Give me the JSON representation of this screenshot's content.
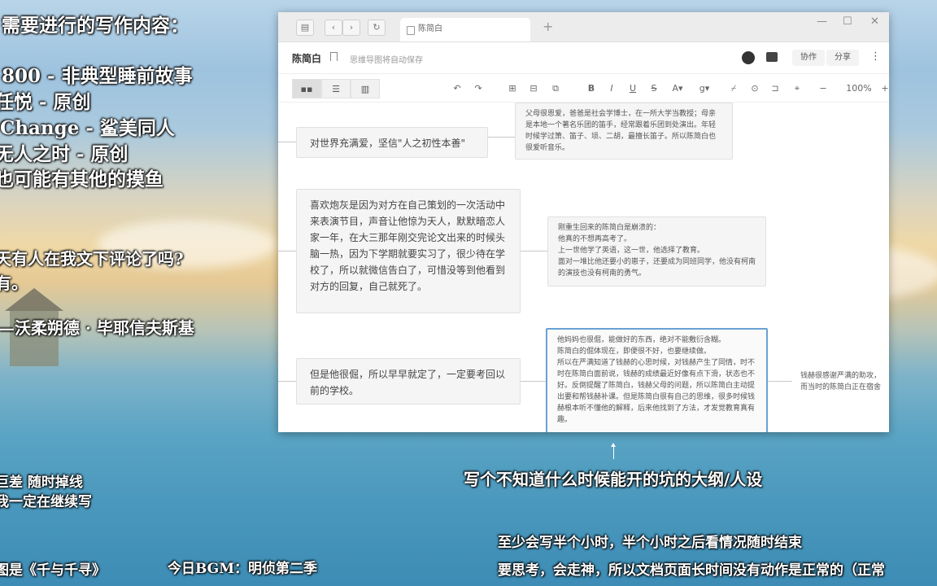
{
  "overlay": {
    "heading": "需要进行的写作内容：",
    "items": [
      "800 - 非典型睡前故事",
      "任悦 - 原创",
      "Change - 鲨美同人",
      "无人之时 - 原创",
      "也可能有其他的摸鱼"
    ],
    "question": "天有人在我文下评论了吗?",
    "answer": "有。",
    "author": "—沃柔朔德 · 毕耶信夫斯基",
    "net1": "巨差   随时掉线",
    "net2": "我一定在继续写",
    "caption": "写个不知道什么时候能开的坑的大纲/人设",
    "note1": "至少会写半个小时，半个小时之后看情况随时结束",
    "note2": "要思考，会走神，所以文档页面长时间没有动作是正常的（正常",
    "wallpaper": "图是《千与千寻》",
    "bgm": "今日BGM：明侦第二季"
  },
  "window": {
    "tab_title": "陈简白",
    "doc_title": "陈简白",
    "autosave": "思维导图将自动保存",
    "collab": "协作",
    "share": "分享",
    "zoom": "100%"
  },
  "nodes": {
    "n1": "对世界充满爱，坚信\"人之初性本善\"",
    "n1_detail": "父母很恩爱，爸爸是社会学博士，在一所大学当教授；母亲是本地一个著名乐团的笛手，经常跟着乐团到处演出。年轻时候学过箫、笛子、埙、二胡，最擅长笛子。所以陈简白也很爱听音乐。",
    "n2": "喜欢炮灰是因为对方在自己策划的一次活动中来表演节目，声音让他惊为天人，默默暗恋人家一年，在大三那年刚交完论文出来的时候头脑一热，因为下学期就要实习了，很少待在学校了，所以就微信告白了，可惜没等到他看到对方的回复，自己就死了。",
    "n2_detail": "刚重生回来的陈简白是崩溃的：\n他真的不想再高考了。\n上一世他学了英语，这一世，他选择了教育。\n面对一堆比他还要小的崽子，还要成为同班同学，他没有柯南的演技也没有柯南的勇气。",
    "n3": "但是他很倔，所以早早就定了，一定要考回以前的学校。",
    "n3_detail": "他妈妈也很倔，能做好的东西，绝对不能敷衍含糊。\n陈简白的倔体现在，即便很不好，也要继续做。\n所以在严满知道了钱赫的心思时候，对钱赫产生了同情，时不时在陈简白面前说，钱赫的成绩最近好像有点下滑，状态也不好。反倒提醒了陈简白，钱赫父母的问题，所以陈简白主动提出要和帮钱赫补课。但是陈简白很有自己的思维，很多时候钱赫根本听不懂他的解释，后来他找到了方法，才发觉教育真有趣。",
    "trailing": "钱赫很感谢严满的助攻，\n而当时的陈简白正在宿舍"
  }
}
